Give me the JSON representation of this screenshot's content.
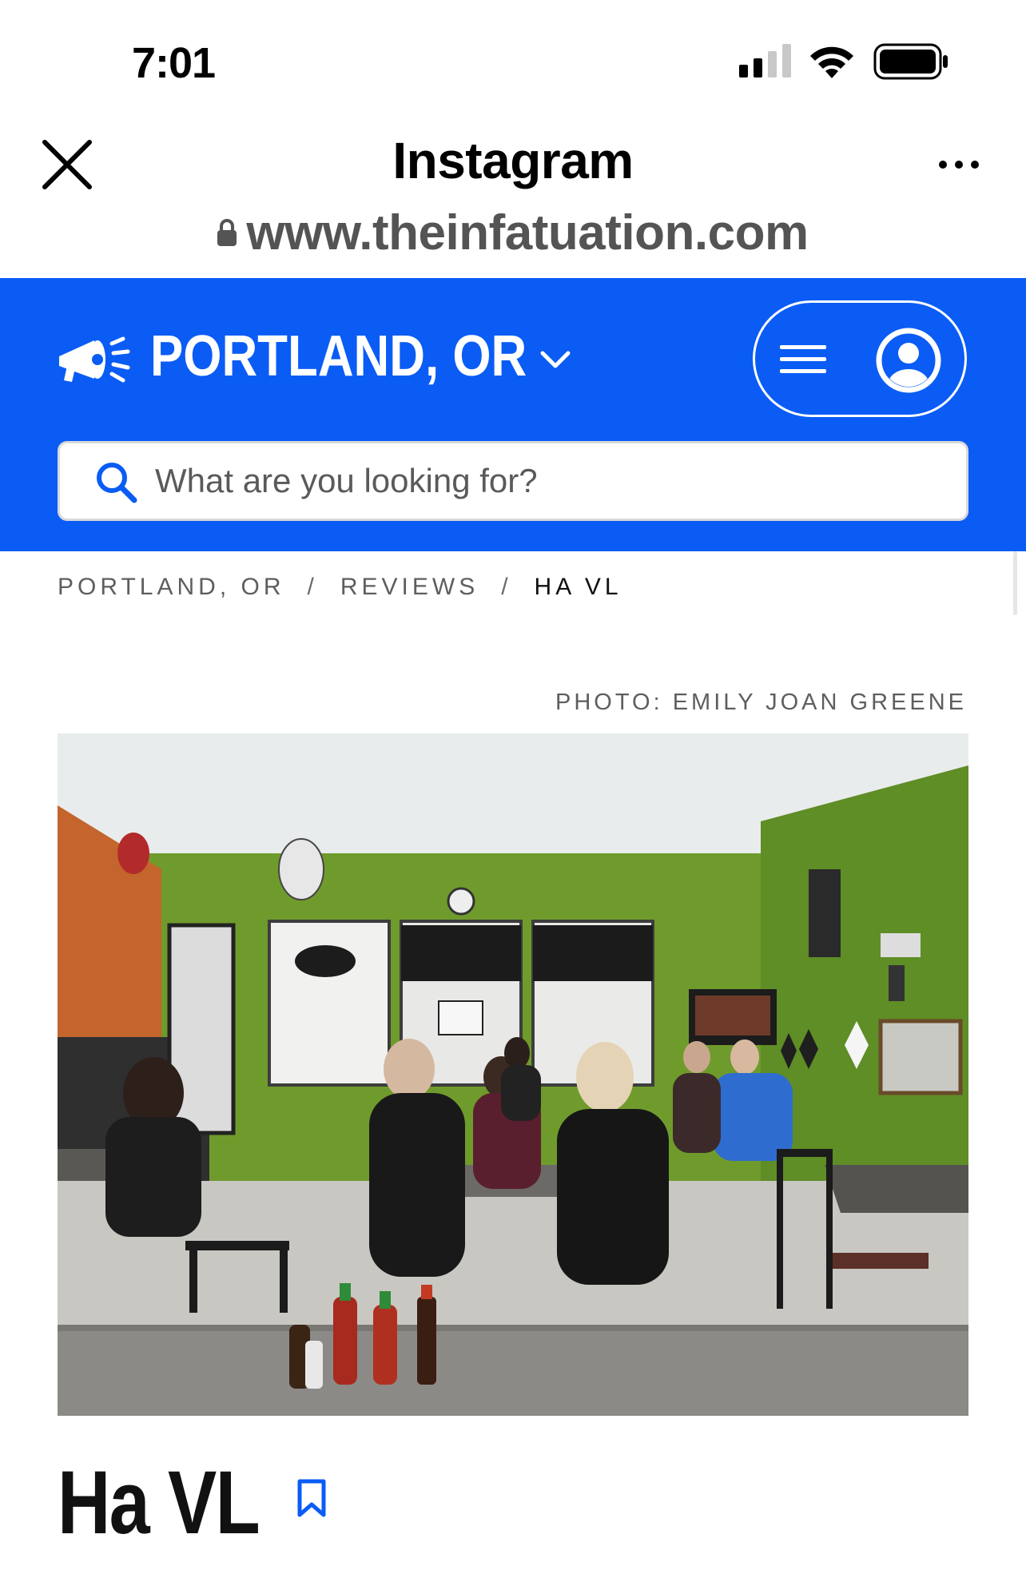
{
  "status_bar": {
    "time": "7:01",
    "icons": [
      "cellular-signal-icon",
      "wifi-icon",
      "battery-icon"
    ]
  },
  "browser": {
    "title": "Instagram",
    "url": "www.theinfatuation.com",
    "icons": [
      "close-icon",
      "more-icon",
      "lock-icon"
    ]
  },
  "site_header": {
    "city": "PORTLAND, OR",
    "icons": [
      "megaphone-logo-icon",
      "chevron-down-icon",
      "hamburger-menu-icon",
      "account-icon"
    ],
    "accent_color": "#0a5cf5",
    "search": {
      "placeholder": "What are you looking for?",
      "value": ""
    }
  },
  "breadcrumb": {
    "items": [
      "PORTLAND, OR",
      "REVIEWS",
      "HA VL"
    ],
    "separator": "/"
  },
  "photo_credit": "PHOTO: EMILY JOAN GREENE",
  "restaurant": {
    "name": "Ha VL",
    "bookmark_icon": "bookmark-icon"
  }
}
